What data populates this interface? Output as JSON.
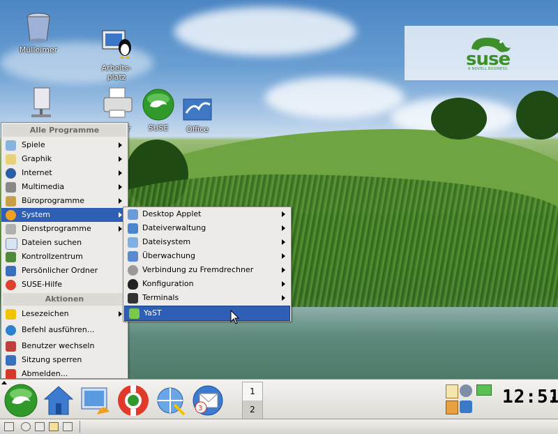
{
  "desktop": {
    "icons": [
      {
        "label": "Mülleimer",
        "icon": "trash-can-icon"
      },
      {
        "label": "Arbeits-\nplatz",
        "icon": "workstation-monitor-icon"
      },
      {
        "label": "",
        "icon": "network-computer-icon"
      },
      {
        "label": "er",
        "icon": "printer-icon"
      },
      {
        "label": "SUSE",
        "icon": "suse-chameleon-icon"
      },
      {
        "label": "Office",
        "icon": "office-seagull-icon"
      }
    ],
    "brand": {
      "word": "suse",
      "tagline": "A NOVELL BUSINESS",
      "color": "#3e8e2c"
    }
  },
  "kmenu": {
    "header_programs": "Alle Programme",
    "programs": [
      {
        "label": "Spiele",
        "icon": "games-icon",
        "submenu": true
      },
      {
        "label": "Graphik",
        "icon": "graphics-icon",
        "submenu": true
      },
      {
        "label": "Internet",
        "icon": "internet-globe-icon",
        "submenu": true
      },
      {
        "label": "Multimedia",
        "icon": "multimedia-icon",
        "submenu": true
      },
      {
        "label": "Büroprogramme",
        "icon": "office-programs-icon",
        "submenu": true
      },
      {
        "label": "System",
        "icon": "system-icon",
        "submenu": true,
        "selected": true
      },
      {
        "label": "Dienstprogramme",
        "icon": "utilities-icon",
        "submenu": true
      },
      {
        "label": "Dateien suchen",
        "icon": "find-files-icon",
        "submenu": false
      },
      {
        "label": "Kontrollzentrum",
        "icon": "control-center-icon",
        "submenu": false
      },
      {
        "label": "Persönlicher Ordner",
        "icon": "home-folder-icon",
        "submenu": false
      },
      {
        "label": "SUSE-Hilfe",
        "icon": "help-lifebuoy-icon",
        "submenu": false
      }
    ],
    "header_actions": "Aktionen",
    "actions": [
      {
        "label": "Lesezeichen",
        "icon": "bookmark-star-icon",
        "submenu": true
      },
      {
        "label": "Befehl ausführen...",
        "icon": "run-command-icon",
        "submenu": false
      },
      {
        "label": "Benutzer wechseln",
        "icon": "switch-user-icon",
        "submenu": false
      },
      {
        "label": "Sitzung sperren",
        "icon": "lock-session-icon",
        "submenu": false
      },
      {
        "label": "Abmelden...",
        "icon": "logout-icon",
        "submenu": false
      }
    ]
  },
  "system_submenu": {
    "items": [
      {
        "label": "Desktop Applet",
        "icon": "desktop-applet-icon",
        "submenu": true
      },
      {
        "label": "Dateiverwaltung",
        "icon": "file-manager-icon",
        "submenu": true
      },
      {
        "label": "Dateisystem",
        "icon": "filesystem-icon",
        "submenu": true
      },
      {
        "label": "Überwachung",
        "icon": "monitoring-icon",
        "submenu": true
      },
      {
        "label": "Verbindung zu Fremdrechner",
        "icon": "remote-connection-icon",
        "submenu": true
      },
      {
        "label": "Konfiguration",
        "icon": "configuration-tux-icon",
        "submenu": true
      },
      {
        "label": "Terminals",
        "icon": "terminal-icon",
        "submenu": true
      },
      {
        "label": "YaST",
        "icon": "yast-icon",
        "submenu": false,
        "selected": true
      }
    ]
  },
  "panel": {
    "launchers": [
      "k-menu-suse-icon",
      "home-icon",
      "desktop-preview-icon",
      "help-lifebuoy-icon",
      "konqueror-web-icon",
      "kmail-icon"
    ],
    "pager": [
      "1",
      "2"
    ],
    "active_desktop": "2",
    "clock": "12:51",
    "tray": [
      "klipper-icon",
      "network-icon",
      "kde-wallet-icon",
      "info-icon",
      "clipboard-icon"
    ]
  },
  "colors": {
    "selection": "#2f5fb5",
    "menu_bg": "#ecebe8"
  }
}
